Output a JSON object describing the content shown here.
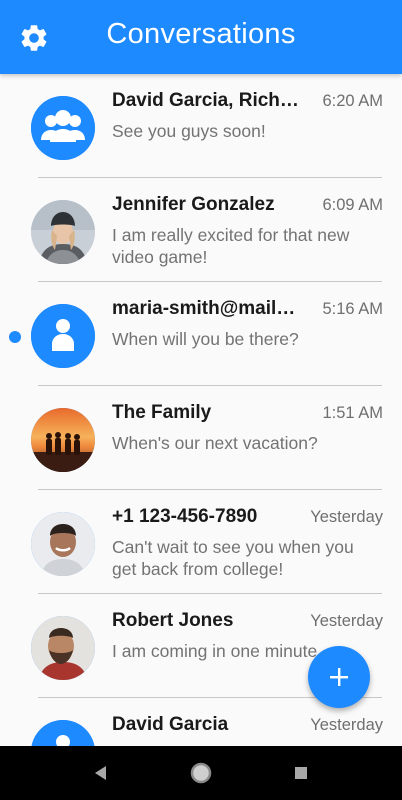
{
  "appbar": {
    "title": "Conversations",
    "settings_icon": "gear-icon"
  },
  "colors": {
    "primary": "#1e8aff",
    "background": "#fafafa",
    "name_text": "#1a1a1a",
    "secondary_text": "#737373",
    "nav_bar": "#000000"
  },
  "conversations": [
    {
      "name": "David Garcia, Rich…",
      "time": "6:20 AM",
      "snippet": "See you guys soon!",
      "avatar": "group-icon",
      "unread": false
    },
    {
      "name": "Jennifer Gonzalez",
      "time": "6:09 AM",
      "snippet": "I am really excited for that new video game!",
      "avatar": "photo-woman-beanie",
      "unread": false
    },
    {
      "name": "maria-smith@mail…",
      "time": "5:16 AM",
      "snippet": "When will you be there?",
      "avatar": "person-icon",
      "unread": true
    },
    {
      "name": "The Family",
      "time": "1:51 AM",
      "snippet": "When's our next vacation?",
      "avatar": "photo-family-sunset",
      "unread": false
    },
    {
      "name": "+1 123-456-7890",
      "time": "Yesterday",
      "snippet": "Can't wait to see you when you get back from college!",
      "avatar": "photo-man-smiling",
      "unread": false
    },
    {
      "name": "Robert Jones",
      "time": "Yesterday",
      "snippet": "I am coming in one minute",
      "avatar": "photo-man-beard",
      "unread": false
    },
    {
      "name": "David Garcia",
      "time": "Yesterday",
      "snippet": "",
      "avatar": "person-icon",
      "unread": false
    }
  ],
  "fab": {
    "icon": "plus-icon"
  },
  "navbar": {
    "back_icon": "back-triangle-icon",
    "home_icon": "home-circle-icon",
    "recents_icon": "recents-square-icon"
  }
}
